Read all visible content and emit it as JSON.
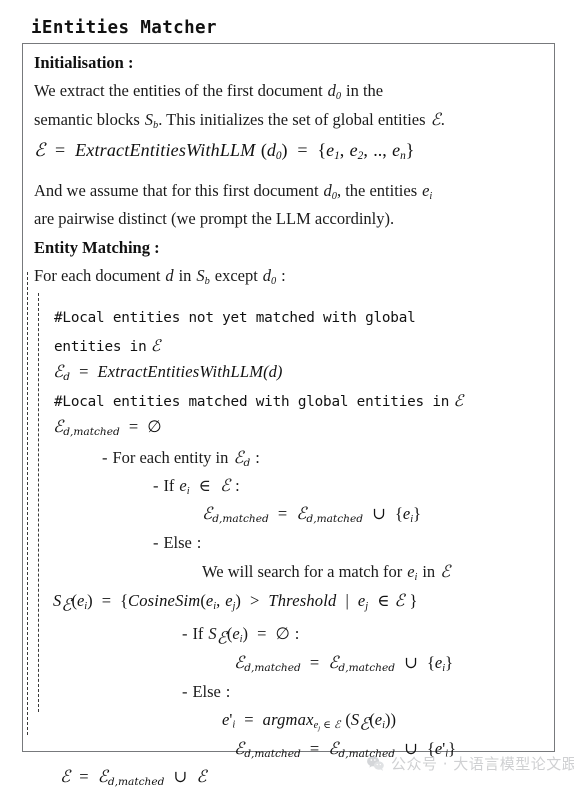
{
  "title": "iEntities Matcher",
  "sections": {
    "init_heading": "Initialisation :",
    "init_line1_a": "We extract the entities of the first document",
    "init_line1_var": "d",
    "init_line1_sub": "0",
    "init_line1_b": "in the",
    "init_line2_a": "semantic blocks",
    "init_line2_var": "S",
    "init_line2_sub": "b",
    "init_line2_b": ". This initializes the set of global entities",
    "init_line2_E": "ℰ",
    "init_line2_c": ".",
    "init_formula": {
      "lhs": "ℰ",
      "eq1": "=",
      "fn": "ExtractEntitiesWithLLM",
      "arg_open": "(",
      "arg_var": "d",
      "arg_sub": "0",
      "arg_close": ")",
      "eq2": "=",
      "set_open": "{",
      "e1": "e",
      "e1_sub": "1",
      "e2": "e",
      "e2_sub": "2",
      "dots": "..,",
      "en": "e",
      "en_sub": "n",
      "set_close": "}"
    },
    "init_line3_a": "And we assume that for this first document",
    "init_line3_var": "d",
    "init_line3_sub": "0",
    "init_line3_b": ", the entities",
    "init_line3_e": "e",
    "init_line3_esub": "i",
    "init_line4": "are pairwise distinct (we prompt the LLM accordinly).",
    "match_heading": "Entity Matching :",
    "match_line1_a": "For each document",
    "match_line1_d": "d",
    "match_line1_b": "in",
    "match_line1_S": "S",
    "match_line1_Ssub": "b",
    "match_line1_c": "except",
    "match_line1_d0": "d",
    "match_line1_d0sub": "0",
    "match_line1_colon": ":"
  },
  "algorithm": {
    "comment1_line1": "#Local entities not yet matched with global",
    "comment1_line2_a": "entities in",
    "comment1_line2_E": "ℰ",
    "extract_d": {
      "lhs": "ℰ",
      "lhs_sub": "d",
      "eq": "=",
      "fn": "ExtractEntitiesWithLLM",
      "arg": "(d)"
    },
    "comment2_a": "#Local entities matched with global entities in",
    "comment2_E": "ℰ",
    "init_matched": {
      "lhs": "ℰ",
      "lhs_sub": "d,matched",
      "eq": "=",
      "rhs": "∅"
    },
    "for_each": {
      "bullet": "-",
      "text_a": "For each entity in",
      "E": "ℰ",
      "E_sub": "d",
      "colon": ":"
    },
    "if_member": {
      "bullet": "-",
      "kw": "If",
      "e": "e",
      "e_sub": "i",
      "in": "∈",
      "E": "ℰ",
      "colon": ":"
    },
    "union_assign_1": {
      "lhs": "ℰ",
      "lhs_sub": "d,matched",
      "eq": "=",
      "rhs": "ℰ",
      "rhs_sub": "d,matched",
      "cup": "∪",
      "set_open": "{",
      "el": "e",
      "el_sub": "i",
      "set_close": "}"
    },
    "else_1": {
      "bullet": "-",
      "kw": "Else",
      "colon": ":"
    },
    "search_text": {
      "text_a": "We will search for a match for",
      "e": "e",
      "e_sub": "i",
      "text_b": "in",
      "E": "ℰ"
    },
    "cosine_formula": {
      "S": "S",
      "S_sub": "ℰ",
      "arg_open": "(",
      "arg_e": "e",
      "arg_sub": "i",
      "arg_close": ")",
      "eq": "=",
      "set_open": "{",
      "fn": "CosineSim",
      "fn_open": "(",
      "fn_e1": "e",
      "fn_e1sub": "i",
      "comma": ",",
      "fn_e2": "e",
      "fn_e2sub": "j",
      "fn_close": ")",
      "gt": ">",
      "threshold": "Threshold",
      "bar": "|",
      "ej": "e",
      "ej_sub": "j",
      "in": "∈",
      "E": "ℰ",
      "set_close": "}"
    },
    "if_empty": {
      "bullet": "-",
      "kw": "If",
      "S": "S",
      "S_sub": "ℰ",
      "arg_open": "(",
      "arg_e": "e",
      "arg_sub": "i",
      "arg_close": ")",
      "eq": "=",
      "empty": "∅",
      "colon": ":"
    },
    "union_assign_2": {
      "lhs": "ℰ",
      "lhs_sub": "d,matched",
      "eq": "=",
      "rhs": "ℰ",
      "rhs_sub": "d,matched",
      "cup": "∪",
      "set_open": "{",
      "el": "e",
      "el_sub": "i",
      "set_close": "}"
    },
    "else_2": {
      "bullet": "-",
      "kw": "Else",
      "colon": ":"
    },
    "argmax_formula": {
      "lhs": "e",
      "lhs_prime": "'",
      "lhs_sub": "i",
      "eq": "=",
      "fn": "argmax",
      "fn_sub_e": "e",
      "fn_sub_j": "j",
      "fn_sub_in": "∈",
      "fn_sub_E": "ℰ",
      "open": "(",
      "S": "S",
      "S_sub": "ℰ",
      "s_open": "(",
      "s_e": "e",
      "s_sub": "i",
      "s_close": ")",
      "close": ")"
    },
    "union_assign_3": {
      "lhs": "ℰ",
      "lhs_sub": "d,matched",
      "eq": "=",
      "rhs": "ℰ",
      "rhs_sub": "d,matched",
      "cup": "∪",
      "set_open": "{",
      "el": "e",
      "el_prime": "'",
      "el_sub": "i",
      "set_close": "}"
    },
    "final_assign": {
      "lhs": "ℰ",
      "eq": "=",
      "rhs": "ℰ",
      "rhs_sub": "d,matched",
      "cup": "∪",
      "last": "ℰ"
    }
  },
  "watermark": {
    "icon": "wechat-icon",
    "text": "公众号 · 大语言模型论文跟踪"
  },
  "colors": {
    "box_border": "#77797c",
    "rail": "#3a3a3a",
    "text": "#1a1a1a",
    "watermark": "#8e9196"
  }
}
